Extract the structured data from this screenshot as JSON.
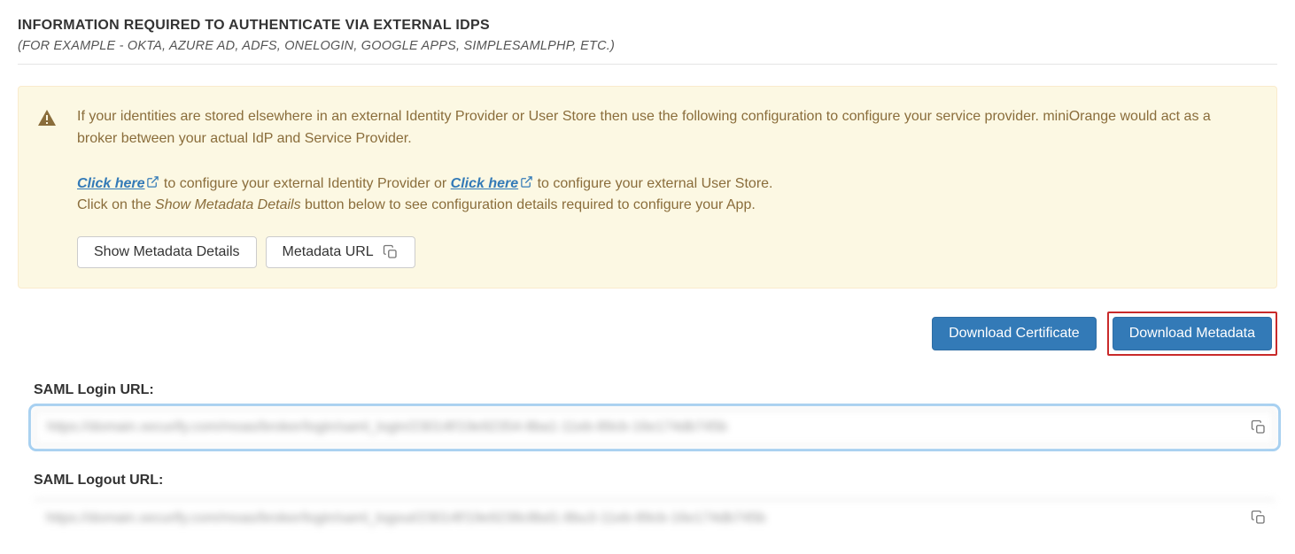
{
  "header": {
    "title": "INFORMATION REQUIRED TO AUTHENTICATE VIA EXTERNAL IDPS",
    "subtitle": "(FOR EXAMPLE - OKTA, AZURE AD, ADFS, ONELOGIN, GOOGLE APPS, SIMPLESAMLPHP, ETC.)"
  },
  "alert": {
    "line1": "If your identities are stored elsewhere in an external Identity Provider or User Store then use the following configuration to configure your service provider. miniOrange would act as a broker between your actual IdP and Service Provider.",
    "click_here_1": "Click here",
    "mid1": " to configure your external Identity Provider or ",
    "click_here_2": "Click here",
    "mid2": " to configure your external User Store.",
    "line3a": "Click on the ",
    "show_meta_text": "Show Metadata Details",
    "line3b": " button below to see configuration details required to configure your App.",
    "btn_show_metadata": "Show Metadata Details",
    "btn_metadata_url": "Metadata URL"
  },
  "download": {
    "certificate": "Download Certificate",
    "metadata": "Download Metadata"
  },
  "fields": {
    "login_label": "SAML Login URL:",
    "login_value": "https://domain.xecurify.com/moas/broker/login/saml_login/23014f/19e92354-8ba1-11eb-89cb-16e174db745b",
    "logout_label": "SAML Logout URL:",
    "logout_value": "https://domain.xecurify.com/moas/broker/login/saml_logout/23014f/19e9238c8bd1-8bu3-11eb-89cb-16e174db745b"
  }
}
